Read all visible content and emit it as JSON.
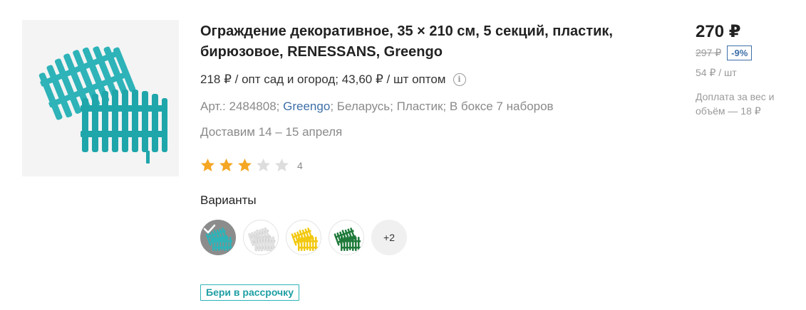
{
  "product": {
    "title": "Ограждение декоративное, 35 × 210 см, 5 секций, пластик, бирюзовое, RENESSANS, Greengo",
    "opt_text": "218 ₽ / опт сад и огород; 43,60 ₽ / шт оптом",
    "art": "Арт.: 2484808;",
    "brand": "Greengo",
    "country": "Беларусь;",
    "material": "Пластик;",
    "box": "В боксе 7 наборов",
    "delivery": "Доставим 14 – 15 апреля",
    "rating": 3,
    "rating_max": 5,
    "review_count": "4",
    "variants_title": "Варианты",
    "variants": [
      {
        "name": "turquoise",
        "color": "#2db3b8",
        "selected": true
      },
      {
        "name": "white",
        "color": "#e6e6e6",
        "selected": false
      },
      {
        "name": "yellow",
        "color": "#f2c811",
        "selected": false
      },
      {
        "name": "green",
        "color": "#1f7a3a",
        "selected": false
      }
    ],
    "more_variants": "+2",
    "installment_label": "Бери в рассрочку"
  },
  "price": {
    "current": "270 ₽",
    "old": "297 ₽",
    "discount": "-9%",
    "unit": "54 ₽ / шт",
    "extra": "Доплата за вес и объём — 18 ₽"
  },
  "colors": {
    "accent": "#2db3b8",
    "link": "#3d6fa8",
    "star": "#f5a623",
    "star_empty": "#dddddd"
  }
}
